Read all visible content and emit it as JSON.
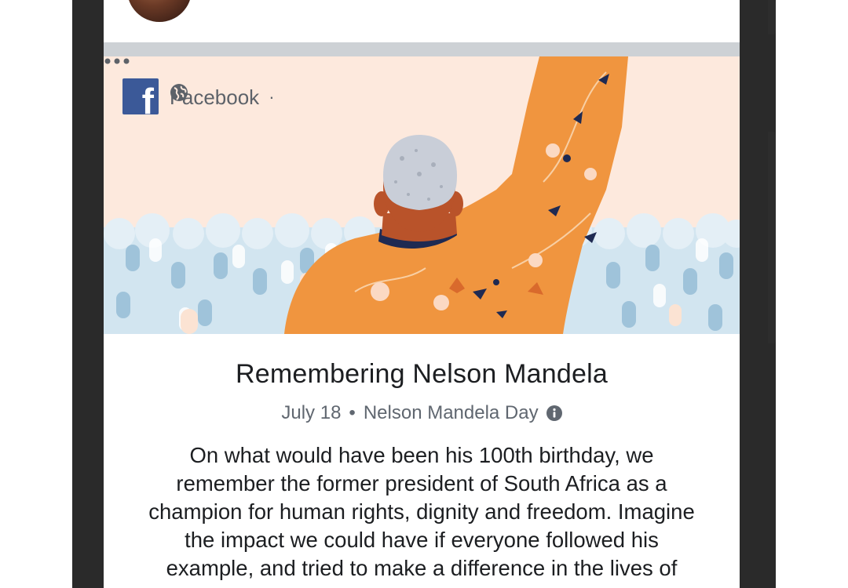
{
  "post": {
    "source": "Facebook",
    "separator_dot": "·",
    "title": "Remembering Nelson Mandela",
    "date": "July 18",
    "event_dot": "•",
    "event": "Nelson Mandela Day",
    "description": "On what would have been his 100th birthday, we remember the former president of South Africa as a champion for human rights, dignity and freedom. Imagine the impact we could have if everyone followed his example, and tried to make a difference in the lives of others."
  },
  "icons": {
    "logo": "facebook-logo",
    "audience": "globe-icon",
    "menu": "more-icon",
    "info": "info-icon"
  },
  "colors": {
    "hero_background": "#fde9dd",
    "facebook_blue": "#3b5998",
    "shirt_orange": "#f0953f",
    "crowd_blue": "#cfe3ef",
    "text_primary": "#1c1e21",
    "text_secondary": "#606770"
  }
}
